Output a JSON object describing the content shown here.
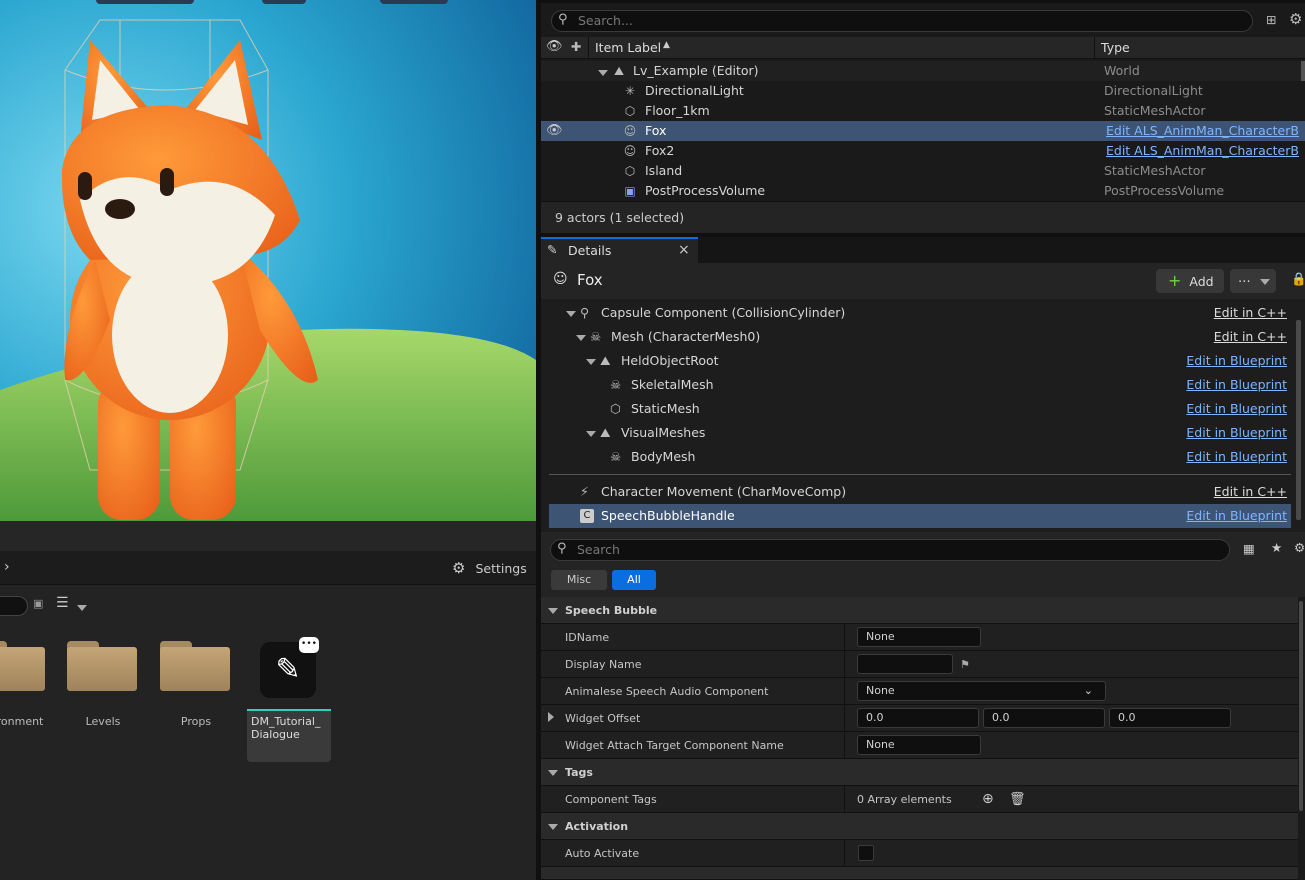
{
  "outliner": {
    "search_placeholder": "Search...",
    "col_label": "Item Label",
    "col_type": "Type",
    "rows": [
      {
        "name": "Lv_Example (Editor)",
        "type": "World",
        "link": false
      },
      {
        "name": "DirectionalLight",
        "type": "DirectionalLight",
        "link": false
      },
      {
        "name": "Floor_1km",
        "type": "StaticMeshActor",
        "link": false
      },
      {
        "name": "Fox",
        "type": "Edit ALS_AnimMan_CharacterBP_",
        "link": true
      },
      {
        "name": "Fox2",
        "type": "Edit ALS_AnimMan_CharacterBP_",
        "link": true
      },
      {
        "name": "Island",
        "type": "StaticMeshActor",
        "link": false
      },
      {
        "name": "PostProcessVolume",
        "type": "PostProcessVolume",
        "link": false
      }
    ],
    "status": "9 actors (1 selected)"
  },
  "details": {
    "tab_label": "Details",
    "close": "×",
    "actor_name": "Fox",
    "add_label": "Add",
    "components": [
      {
        "name": "Capsule Component (CollisionCylinder)",
        "edit": "Edit in C++"
      },
      {
        "name": "Mesh (CharacterMesh0)",
        "edit": "Edit in C++"
      },
      {
        "name": "HeldObjectRoot",
        "edit": "Edit in Blueprint"
      },
      {
        "name": "SkeletalMesh",
        "edit": "Edit in Blueprint"
      },
      {
        "name": "StaticMesh",
        "edit": "Edit in Blueprint"
      },
      {
        "name": "VisualMeshes",
        "edit": "Edit in Blueprint"
      },
      {
        "name": "BodyMesh",
        "edit": "Edit in Blueprint"
      },
      {
        "name": "Character Movement (CharMoveComp)",
        "edit": "Edit in C++"
      },
      {
        "name": "SpeechBubbleHandle",
        "edit": "Edit in Blueprint"
      }
    ],
    "search_placeholder": "Search",
    "filter_misc": "Misc",
    "filter_all": "All",
    "sections": {
      "speech_bubble": "Speech Bubble",
      "tags": "Tags",
      "activation": "Activation"
    },
    "props": {
      "idname_label": "IDName",
      "idname_value": "None",
      "display_name_label": "Display Name",
      "display_name_value": "",
      "animalese_label": "Animalese Speech Audio Component",
      "animalese_value": "None",
      "widget_offset_label": "Widget Offset",
      "widget_offset": [
        "0.0",
        "0.0",
        "0.0"
      ],
      "attach_label": "Widget Attach Target Component Name",
      "attach_value": "None",
      "component_tags_label": "Component Tags",
      "component_tags_value": "0 Array elements",
      "auto_activate_label": "Auto Activate",
      "auto_activate": false
    }
  },
  "content_browser": {
    "settings_label": "Settings",
    "items": [
      "ronment",
      "Levels",
      "Props",
      "DM_Tutorial_ Dialogue"
    ]
  },
  "colors": {
    "selection": "#3d5475",
    "link": "#7fb5ff",
    "accent_blue": "#0a6ee0"
  }
}
